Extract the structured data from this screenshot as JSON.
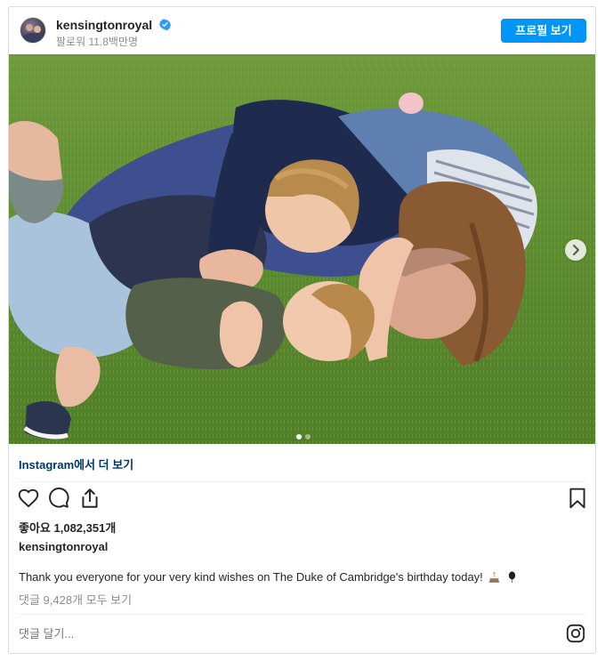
{
  "post": {
    "username": "kensingtonroyal",
    "followers_text": "팔로워 11.8백만명",
    "profile_button": "프로필 보기",
    "verified_icon": "verified-badge-icon",
    "carousel": {
      "slide_count": 2,
      "active_index": 0
    },
    "see_more_text": "Instagram에서 더 보기",
    "likes_text": "좋아요 1,082,351개",
    "caption_owner": "kensingtonroyal",
    "caption_text": "Thank you everyone for your very kind wishes on The Duke of Cambridge's birthday today!",
    "caption_emoji": [
      "birthday-cake-icon",
      "balloon-icon"
    ],
    "comments_link": "댓글 9,428개 모두 보기",
    "comment_placeholder": "댓글 달기...",
    "icons": [
      "heart-icon",
      "comment-icon",
      "share-icon",
      "bookmark-icon",
      "instagram-logo-icon",
      "chevron-right-icon"
    ]
  },
  "colors": {
    "primary_button": "#0095f6",
    "link": "#00376b",
    "verified": "#3897f0",
    "muted_text": "#8e8e8e",
    "border": "#dbdbdb"
  }
}
